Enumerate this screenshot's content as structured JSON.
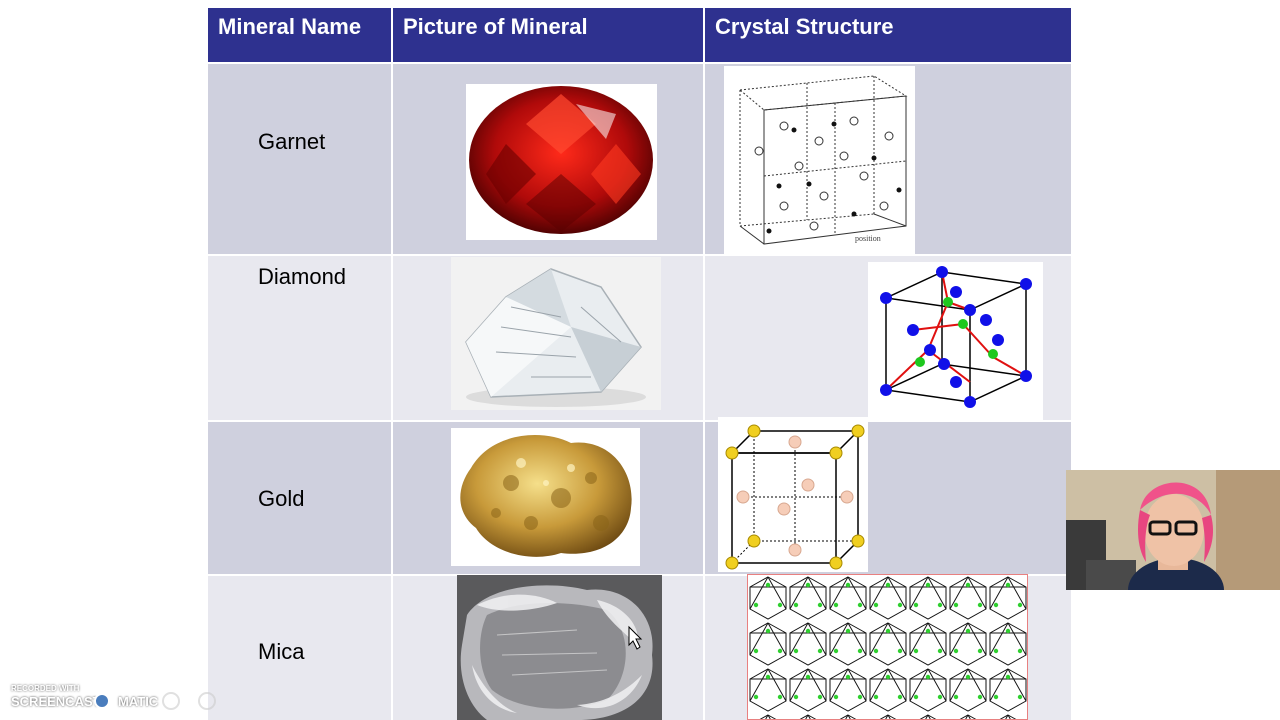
{
  "headers": [
    "Mineral Name",
    "Picture of Mineral",
    "Crystal Structure"
  ],
  "rows": [
    {
      "name": "Garnet"
    },
    {
      "name": "Diamond"
    },
    {
      "name": "Gold"
    },
    {
      "name": "Mica"
    }
  ],
  "garnet_structure_caption": "position",
  "watermark": {
    "top": "RECORDED WITH",
    "brand_left": "SCREENCAST",
    "brand_right": "MATIC"
  }
}
